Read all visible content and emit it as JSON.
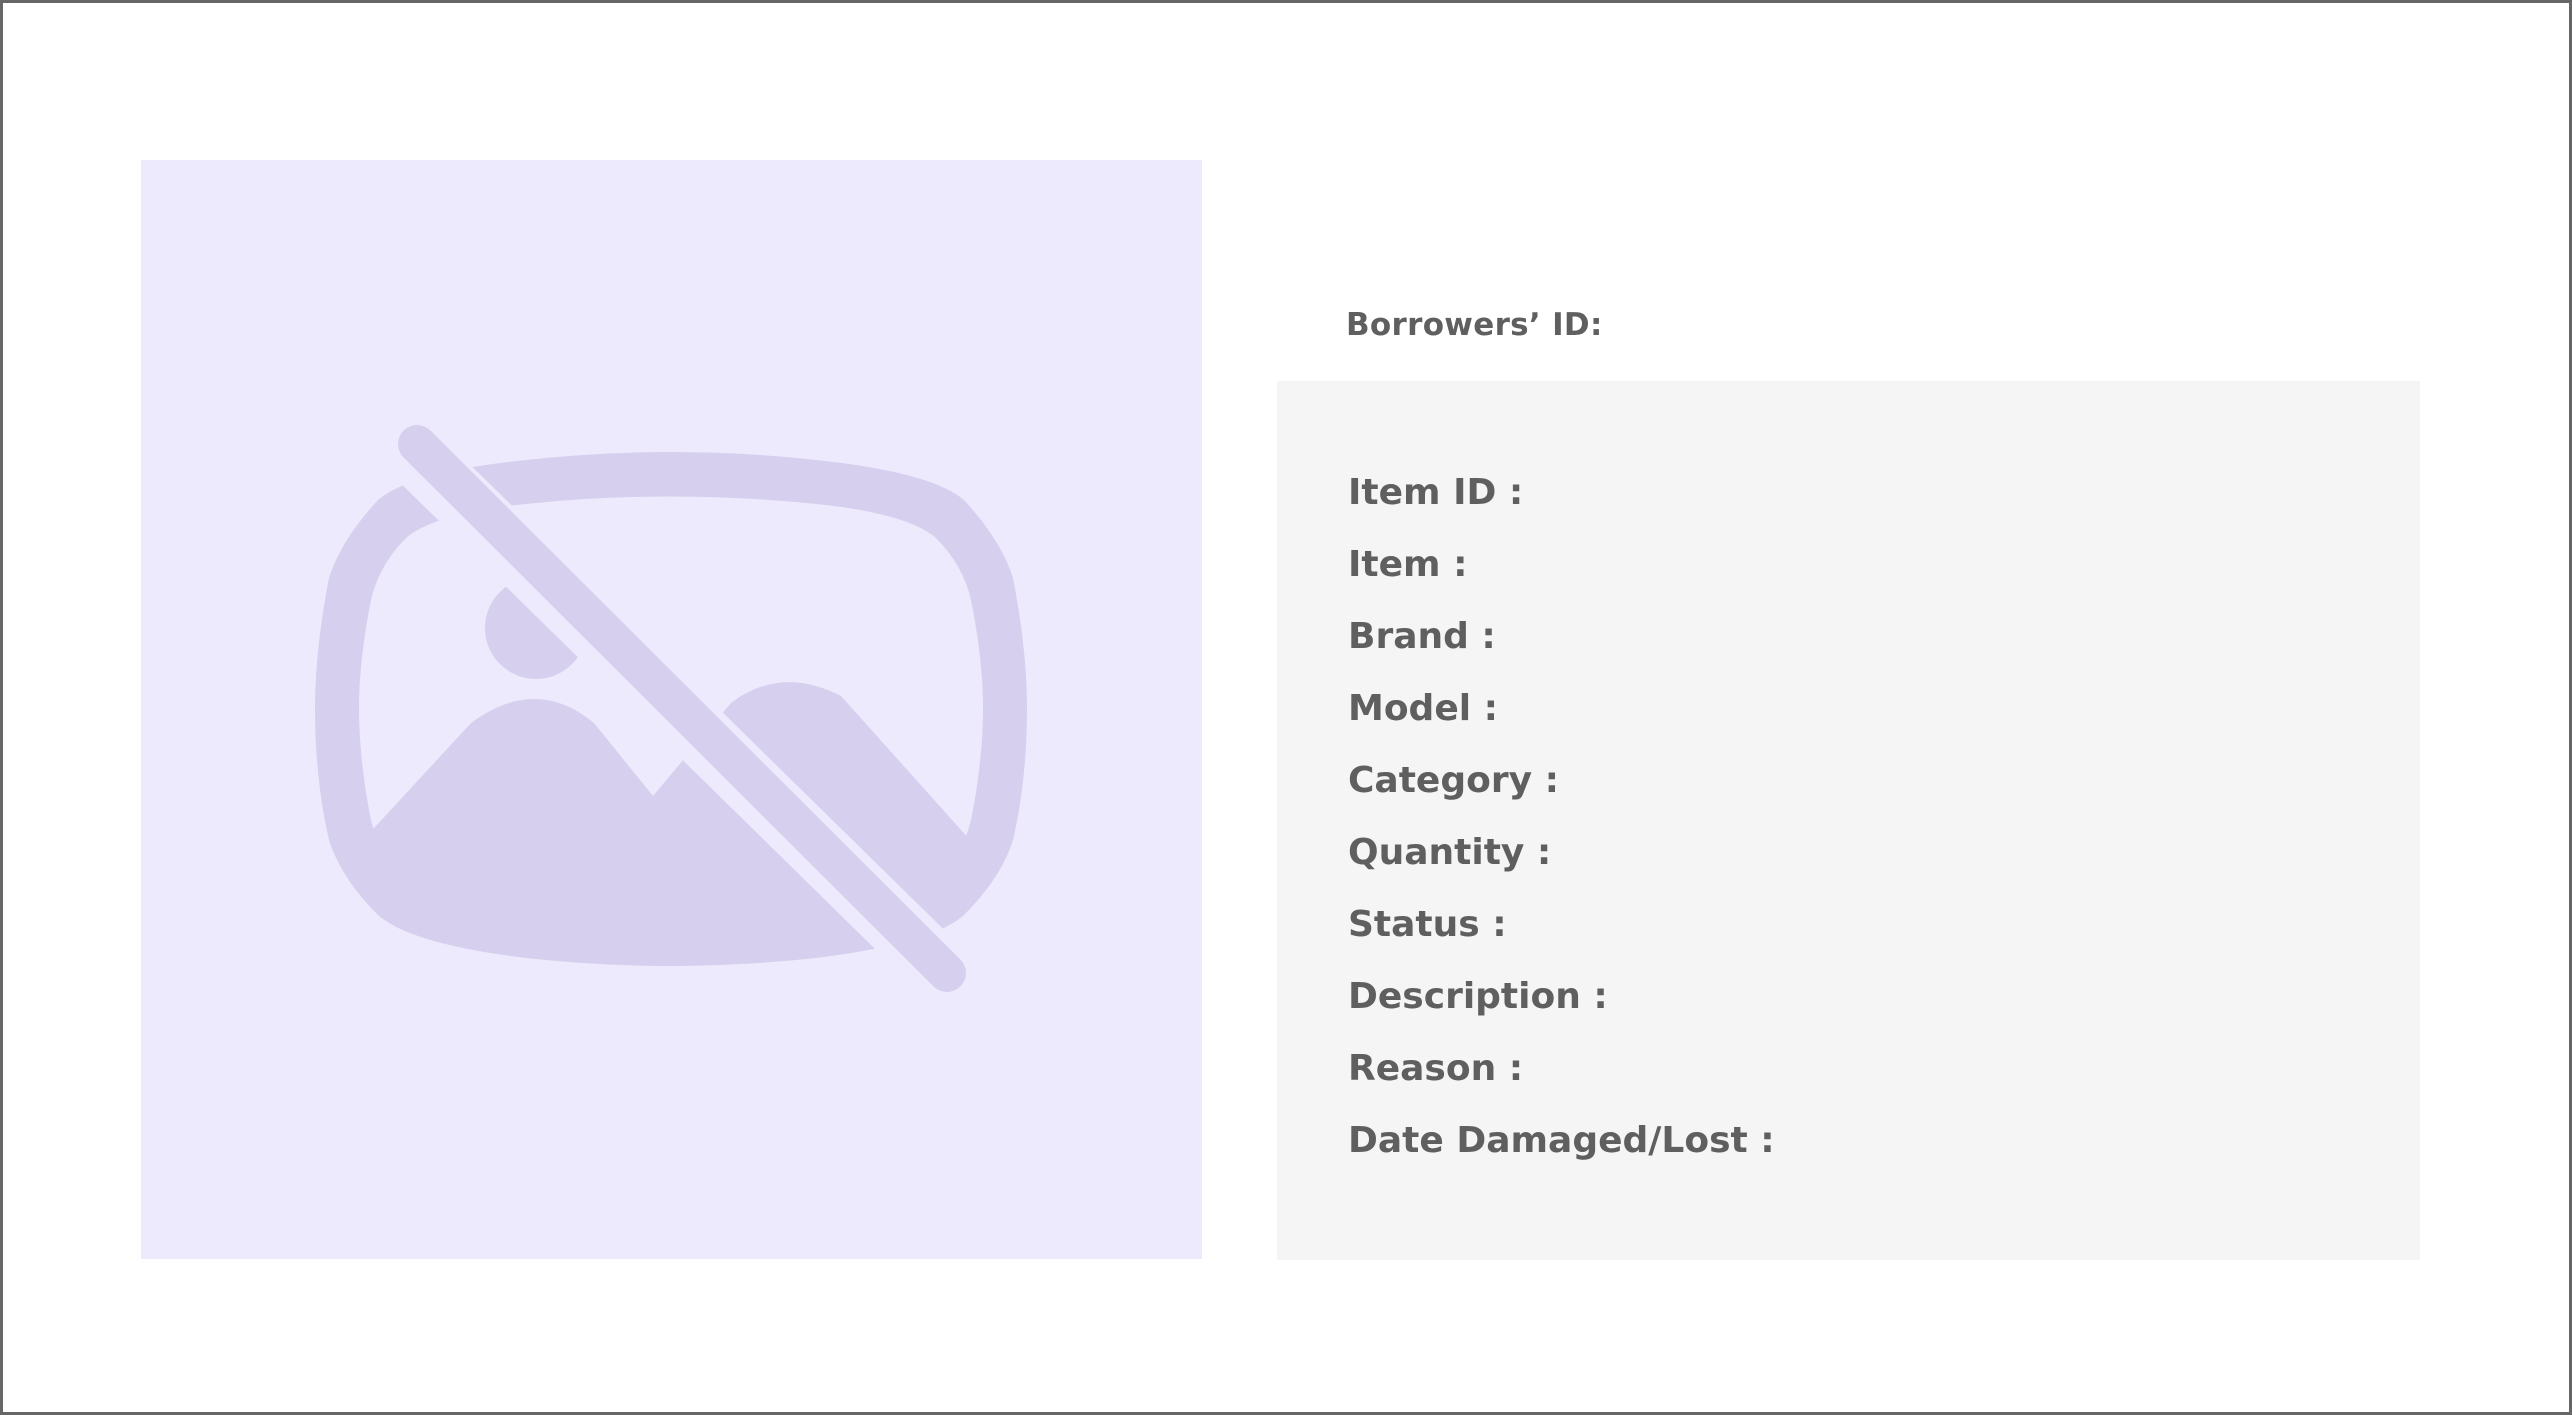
{
  "borrower": {
    "id_label": "Borrowers’ ID:"
  },
  "image": {
    "icon": "image-not-supported-icon",
    "background_color": "#edeafd",
    "icon_color": "#d6cfee"
  },
  "details": {
    "fields": [
      {
        "label": "Item ID :"
      },
      {
        "label": "Item :"
      },
      {
        "label": "Brand :"
      },
      {
        "label": "Model :"
      },
      {
        "label": "Category :"
      },
      {
        "label": "Quantity :"
      },
      {
        "label": "Status :"
      },
      {
        "label": "Description :"
      },
      {
        "label": "Reason :"
      },
      {
        "label": "Date Damaged/Lost :"
      }
    ]
  }
}
